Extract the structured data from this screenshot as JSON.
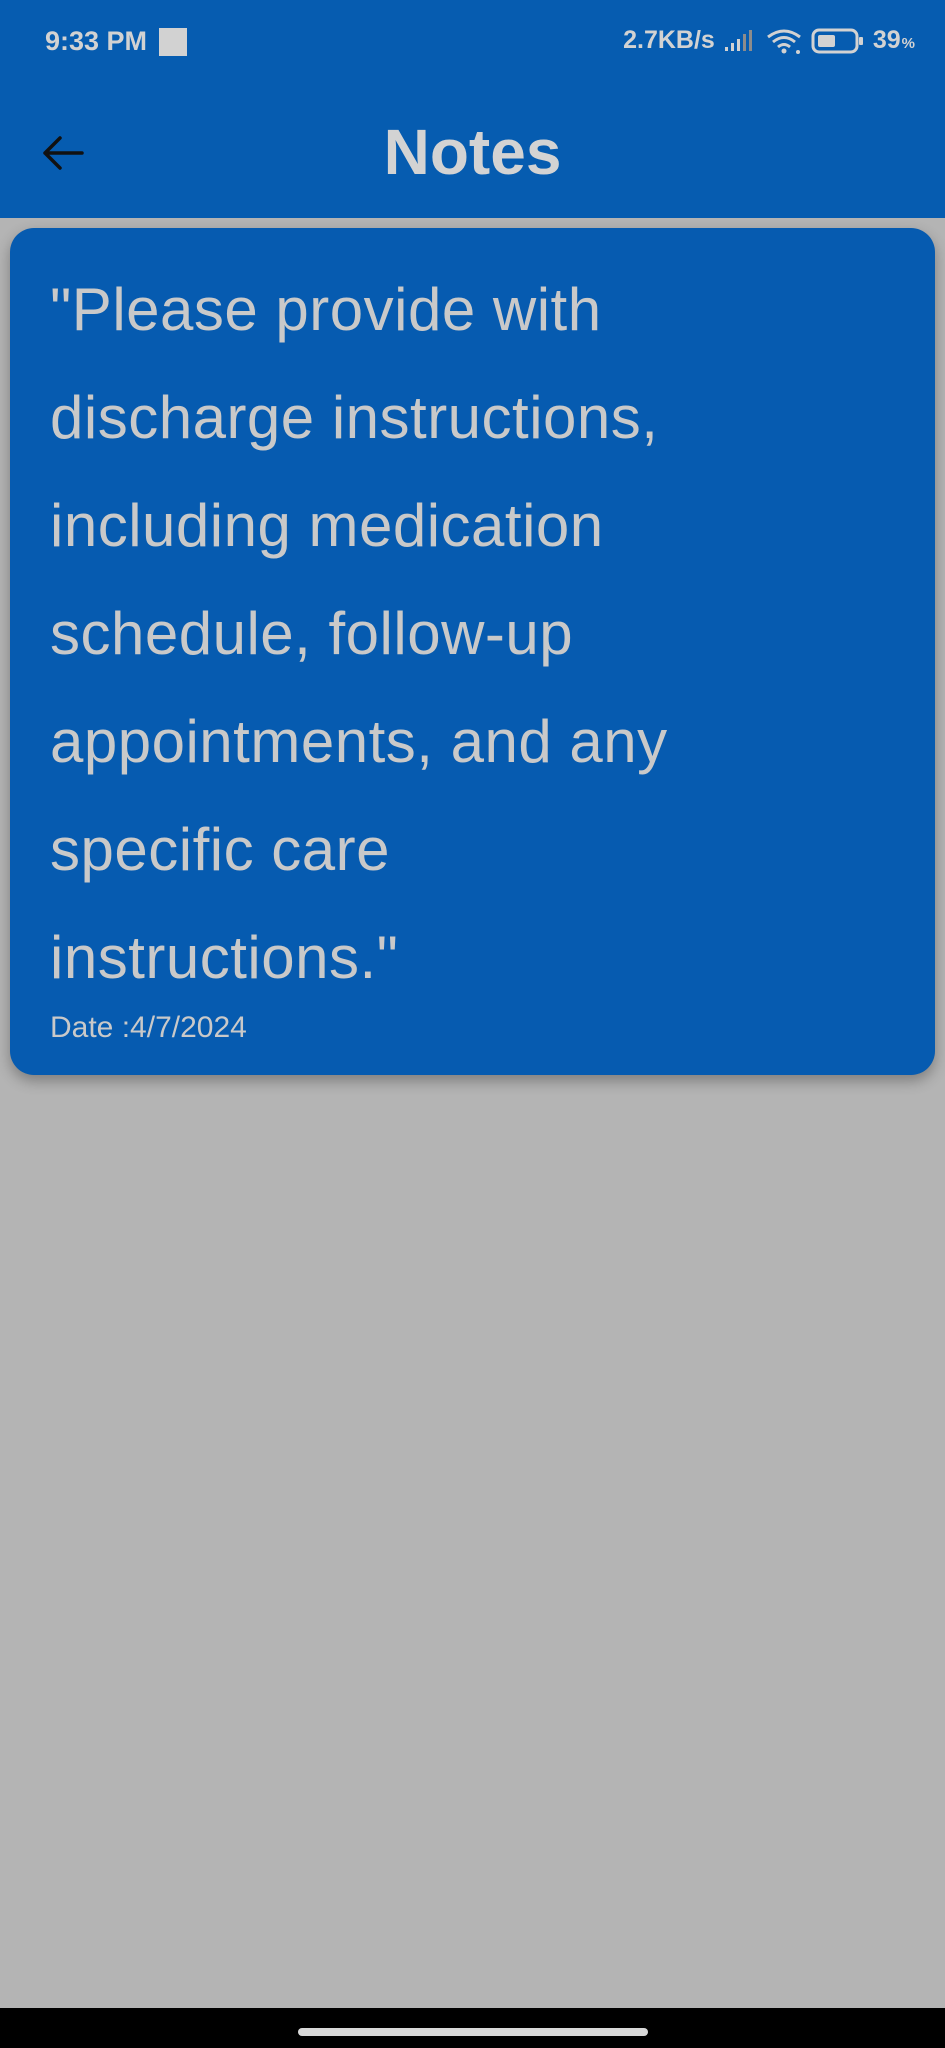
{
  "status_bar": {
    "time": "9:33 PM",
    "network_speed": "2.7KB/s",
    "battery_level": "39",
    "battery_unit": "%",
    "icons": [
      "notification-square-icon",
      "signal-icon",
      "wifi-icon",
      "battery-icon"
    ]
  },
  "app_bar": {
    "title": "Notes",
    "back_icon": "arrow-left-icon"
  },
  "notes": [
    {
      "text": "\"Please provide with\ndischarge instructions,\nincluding medication\nschedule, follow-up\nappointments, and any\nspecific care\ninstructions.\"",
      "date_label": "Date :",
      "date": "4/7/2024"
    }
  ],
  "colors": {
    "app_bar": "#065cb0",
    "card": "#065bb0",
    "background": "#b4b4b4",
    "text": "#c9c9c9"
  }
}
